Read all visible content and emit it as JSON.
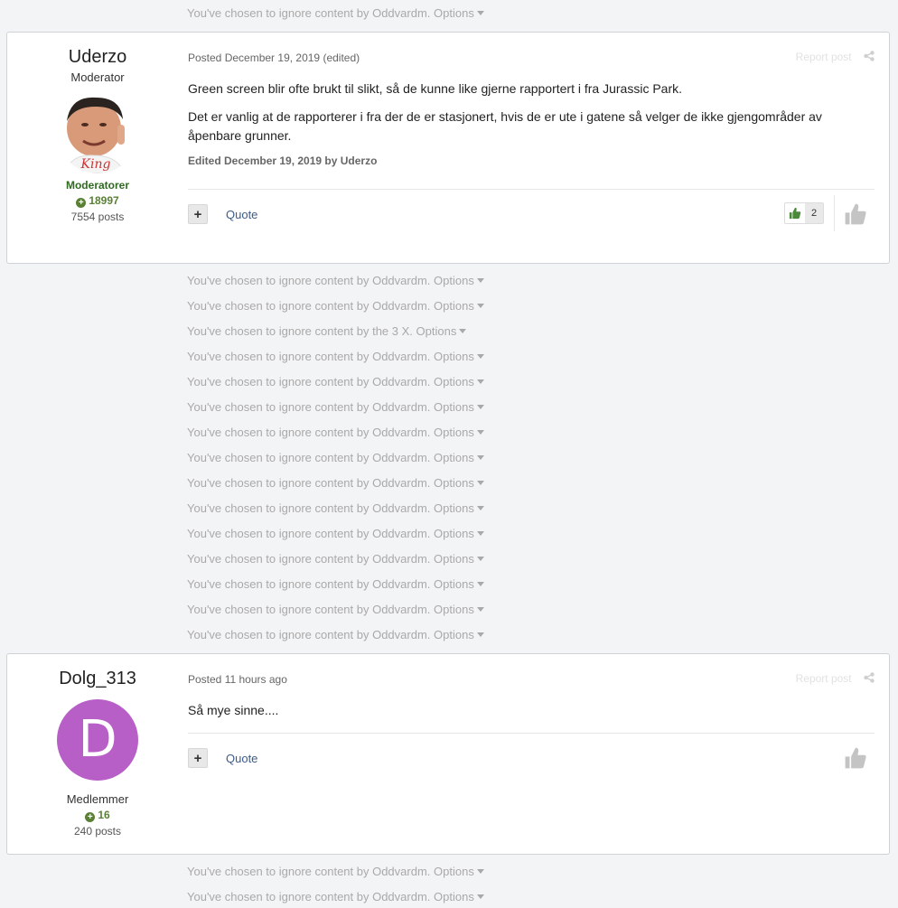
{
  "ignored_top": "You've chosen to ignore content by Oddvardm.",
  "options_label": "Options",
  "ignored_middle": [
    "You've chosen to ignore content by Oddvardm.",
    "You've chosen to ignore content by Oddvardm.",
    "You've chosen to ignore content by the 3 X.",
    "You've chosen to ignore content by Oddvardm.",
    "You've chosen to ignore content by Oddvardm.",
    "You've chosen to ignore content by Oddvardm.",
    "You've chosen to ignore content by Oddvardm.",
    "You've chosen to ignore content by Oddvardm.",
    "You've chosen to ignore content by Oddvardm.",
    "You've chosen to ignore content by Oddvardm.",
    "You've chosen to ignore content by Oddvardm.",
    "You've chosen to ignore content by Oddvardm.",
    "You've chosen to ignore content by Oddvardm.",
    "You've chosen to ignore content by Oddvardm.",
    "You've chosen to ignore content by Oddvardm."
  ],
  "ignored_bottom": [
    "You've chosen to ignore content by Oddvardm.",
    "You've chosen to ignore content by Oddvardm."
  ],
  "post1": {
    "author": "Uderzo",
    "title": "Moderator",
    "group": "Moderatorer",
    "group_color": "#2e6b1f",
    "reputation": "18997",
    "post_count": "7554 posts",
    "posted_label": "Posted",
    "date": "December 19, 2019",
    "edited_flag": "(edited)",
    "report": "Report post",
    "paragraphs": [
      "Green screen blir ofte brukt til slikt, så de kunne like gjerne rapportert i fra Jurassic Park.",
      "Det er vanlig at de rapporterer i fra der de er stasjonert, hvis de er ute i gatene så velger de ikke gjengområder av åpenbare grunner."
    ],
    "edited_note": "Edited December 19, 2019 by Uderzo",
    "quote_label": "Quote",
    "reaction_count": "2",
    "avatar_text": "King"
  },
  "post2": {
    "author": "Dolg_313",
    "avatar_letter": "D",
    "avatar_color": "#b75fc7",
    "group": "Medlemmer",
    "reputation": "16",
    "post_count": "240 posts",
    "posted_label": "Posted",
    "date": "11 hours ago",
    "report": "Report post",
    "body": "Så mye sinne....",
    "quote_label": "Quote"
  },
  "colors": {
    "reputation_green": "#5a7f36",
    "link_blue": "#3c5b8a",
    "like_green": "#4a8a3a"
  }
}
